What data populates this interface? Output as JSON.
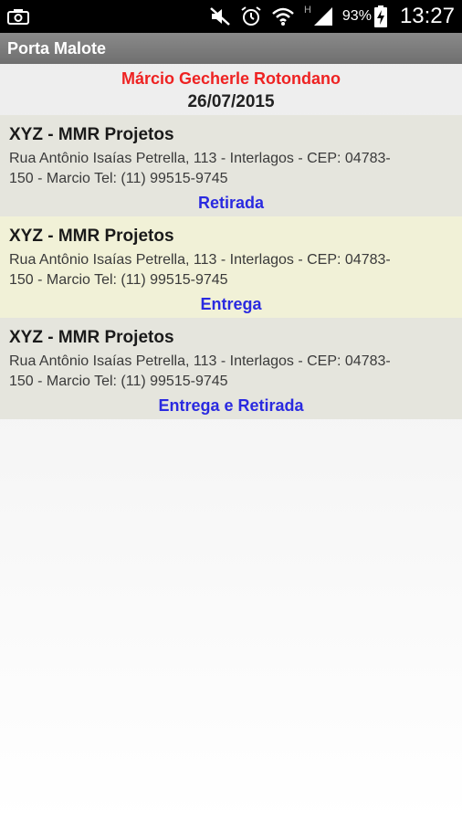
{
  "status_bar": {
    "battery_percent": "93%",
    "time": "13:27",
    "network_label": "H",
    "icons": [
      "screenshot-icon",
      "mute-icon",
      "alarm-icon",
      "wifi-icon",
      "signal-icon",
      "battery-charging-icon"
    ]
  },
  "app": {
    "title": "Porta Malote"
  },
  "header": {
    "person_name": "Márcio Gecherle Rotondano",
    "date": "26/07/2015"
  },
  "items": [
    {
      "title": "XYZ - MMR Projetos",
      "address": "Rua Antônio Isaías Petrella, 113 - Interlagos - CEP: 04783-150 - Marcio Tel: (11) 99515-9745",
      "action": "Retirada"
    },
    {
      "title": "XYZ - MMR Projetos",
      "address": "Rua Antônio Isaías Petrella, 113 - Interlagos - CEP: 04783-150 - Marcio Tel: (11) 99515-9745",
      "action": "Entrega"
    },
    {
      "title": "XYZ - MMR Projetos",
      "address": "Rua Antônio Isaías Petrella, 113 - Interlagos - CEP: 04783-150 - Marcio Tel: (11) 99515-9745",
      "action": "Entrega e Retirada"
    }
  ],
  "colors": {
    "name_red": "#ee2222",
    "action_blue": "#2a2ae0",
    "row_odd": "#e5e5dd",
    "row_even": "#f1f1d7",
    "action_bar": "#7a7a7a"
  }
}
